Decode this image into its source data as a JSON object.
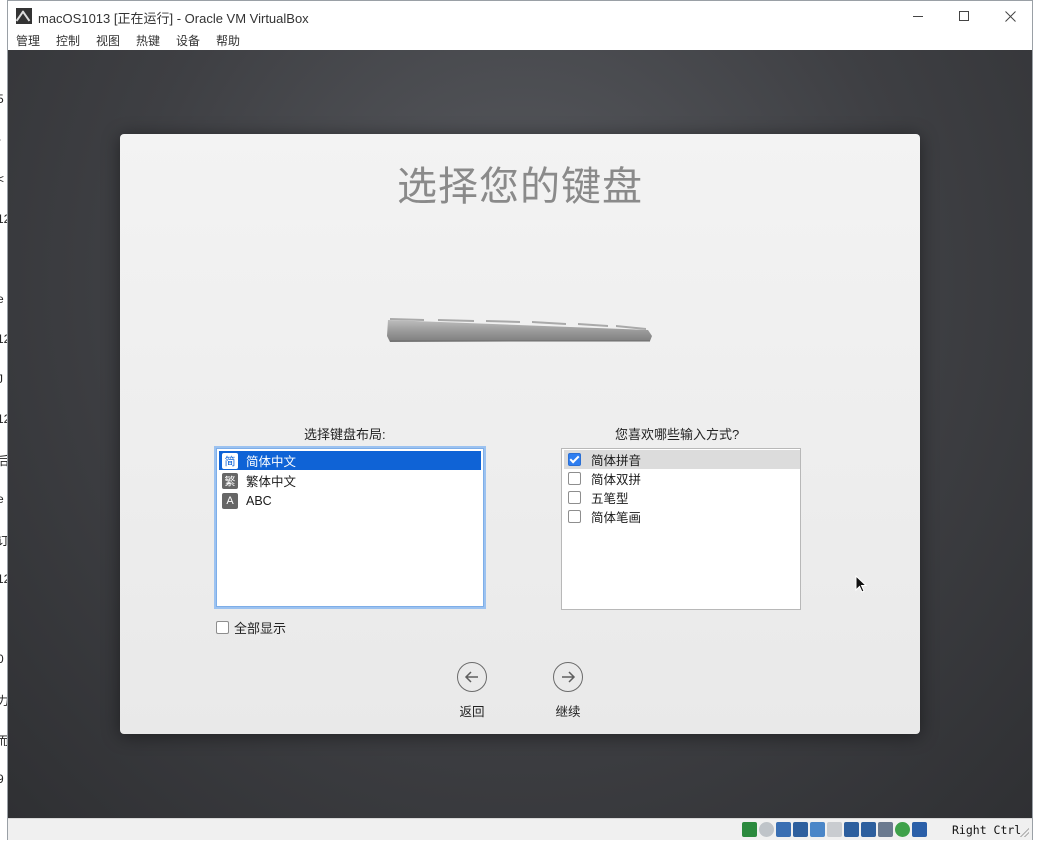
{
  "background_fragments": [
    "5",
    "-",
    "<",
    "12",
    "e",
    "12",
    "J",
    "12",
    "后",
    "e",
    "订",
    "12",
    "0",
    "力",
    "而",
    "9"
  ],
  "window": {
    "title": "macOS1013 [正在运行] - Oracle VM VirtualBox",
    "app_icon": "virtualbox-icon",
    "controls": [
      "minimize-icon",
      "maximize-icon",
      "close-icon"
    ]
  },
  "menubar": {
    "items": [
      "管理",
      "控制",
      "视图",
      "热键",
      "设备",
      "帮助"
    ]
  },
  "setup": {
    "title": "选择您的键盘",
    "layout_label": "选择键盘布局:",
    "layouts": [
      {
        "badge": "简",
        "label": "简体中文",
        "selected": true
      },
      {
        "badge": "繁",
        "label": "繁体中文",
        "selected": false
      },
      {
        "badge": "A",
        "label": "ABC",
        "selected": false
      }
    ],
    "show_all_label": "全部显示",
    "show_all_checked": false,
    "input_label": "您喜欢哪些输入方式?",
    "input_methods": [
      {
        "label": "简体拼音",
        "checked": true
      },
      {
        "label": "简体双拼",
        "checked": false
      },
      {
        "label": "五笔型",
        "checked": false
      },
      {
        "label": "简体笔画",
        "checked": false
      }
    ],
    "back_label": "返回",
    "continue_label": "继续"
  },
  "statusbar": {
    "icons": [
      "hard-disk-icon",
      "optical-disk-icon",
      "audio-icon",
      "network-icon",
      "usb-icon",
      "shared-folder-icon",
      "display-icon",
      "video-capture-icon",
      "recording-icon",
      "cpu-icon",
      "mouse-integration-icon"
    ],
    "icon_colors": [
      "#2b8a3e",
      "#bfc4c9",
      "#3a6fb3",
      "#2d5f9e",
      "#4a86c8",
      "#c9ccd0",
      "#2d5f9e",
      "#2d5f9e",
      "#6b7a8f",
      "#3fa14a",
      "#2a5fa8"
    ],
    "host_key": "Right Ctrl"
  },
  "colors": {
    "selection": "#0f63d6",
    "checkbox_checked": "#2f7ef0",
    "title_gray": "#8a8a8a"
  }
}
